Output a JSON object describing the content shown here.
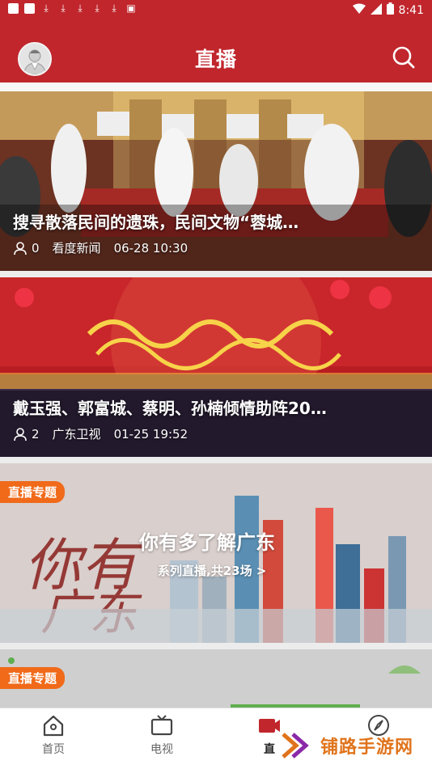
{
  "status": {
    "time": "8:41"
  },
  "header": {
    "title": "直播"
  },
  "cards": [
    {
      "title": "搜寻散落民间的遗珠，民间文物“蓉城…",
      "viewers": "0",
      "source": "看度新闻",
      "time": "06-28 10:30"
    },
    {
      "title": "戴玉强、郭富城、蔡明、孙楠倾情助阵20…",
      "viewers": "2",
      "source": "广东卫视",
      "time": "01-25 19:52"
    }
  ],
  "topics": [
    {
      "badge": "直播专题",
      "title": "你有多了解广东",
      "subtitle": "系列直播,共23场 >"
    },
    {
      "badge": "直播专题"
    }
  ],
  "tabbar": {
    "items": [
      {
        "label": "首页",
        "icon": "home-icon"
      },
      {
        "label": "电视",
        "icon": "tv-icon"
      },
      {
        "label": "直",
        "icon": "live-icon"
      },
      {
        "label": "",
        "icon": "compass-icon"
      }
    ]
  },
  "watermark": {
    "text": "铺路手游网"
  },
  "colors": {
    "brand": "#c0262c",
    "badge": "#f06a1a",
    "watermark": "#e0741c"
  }
}
